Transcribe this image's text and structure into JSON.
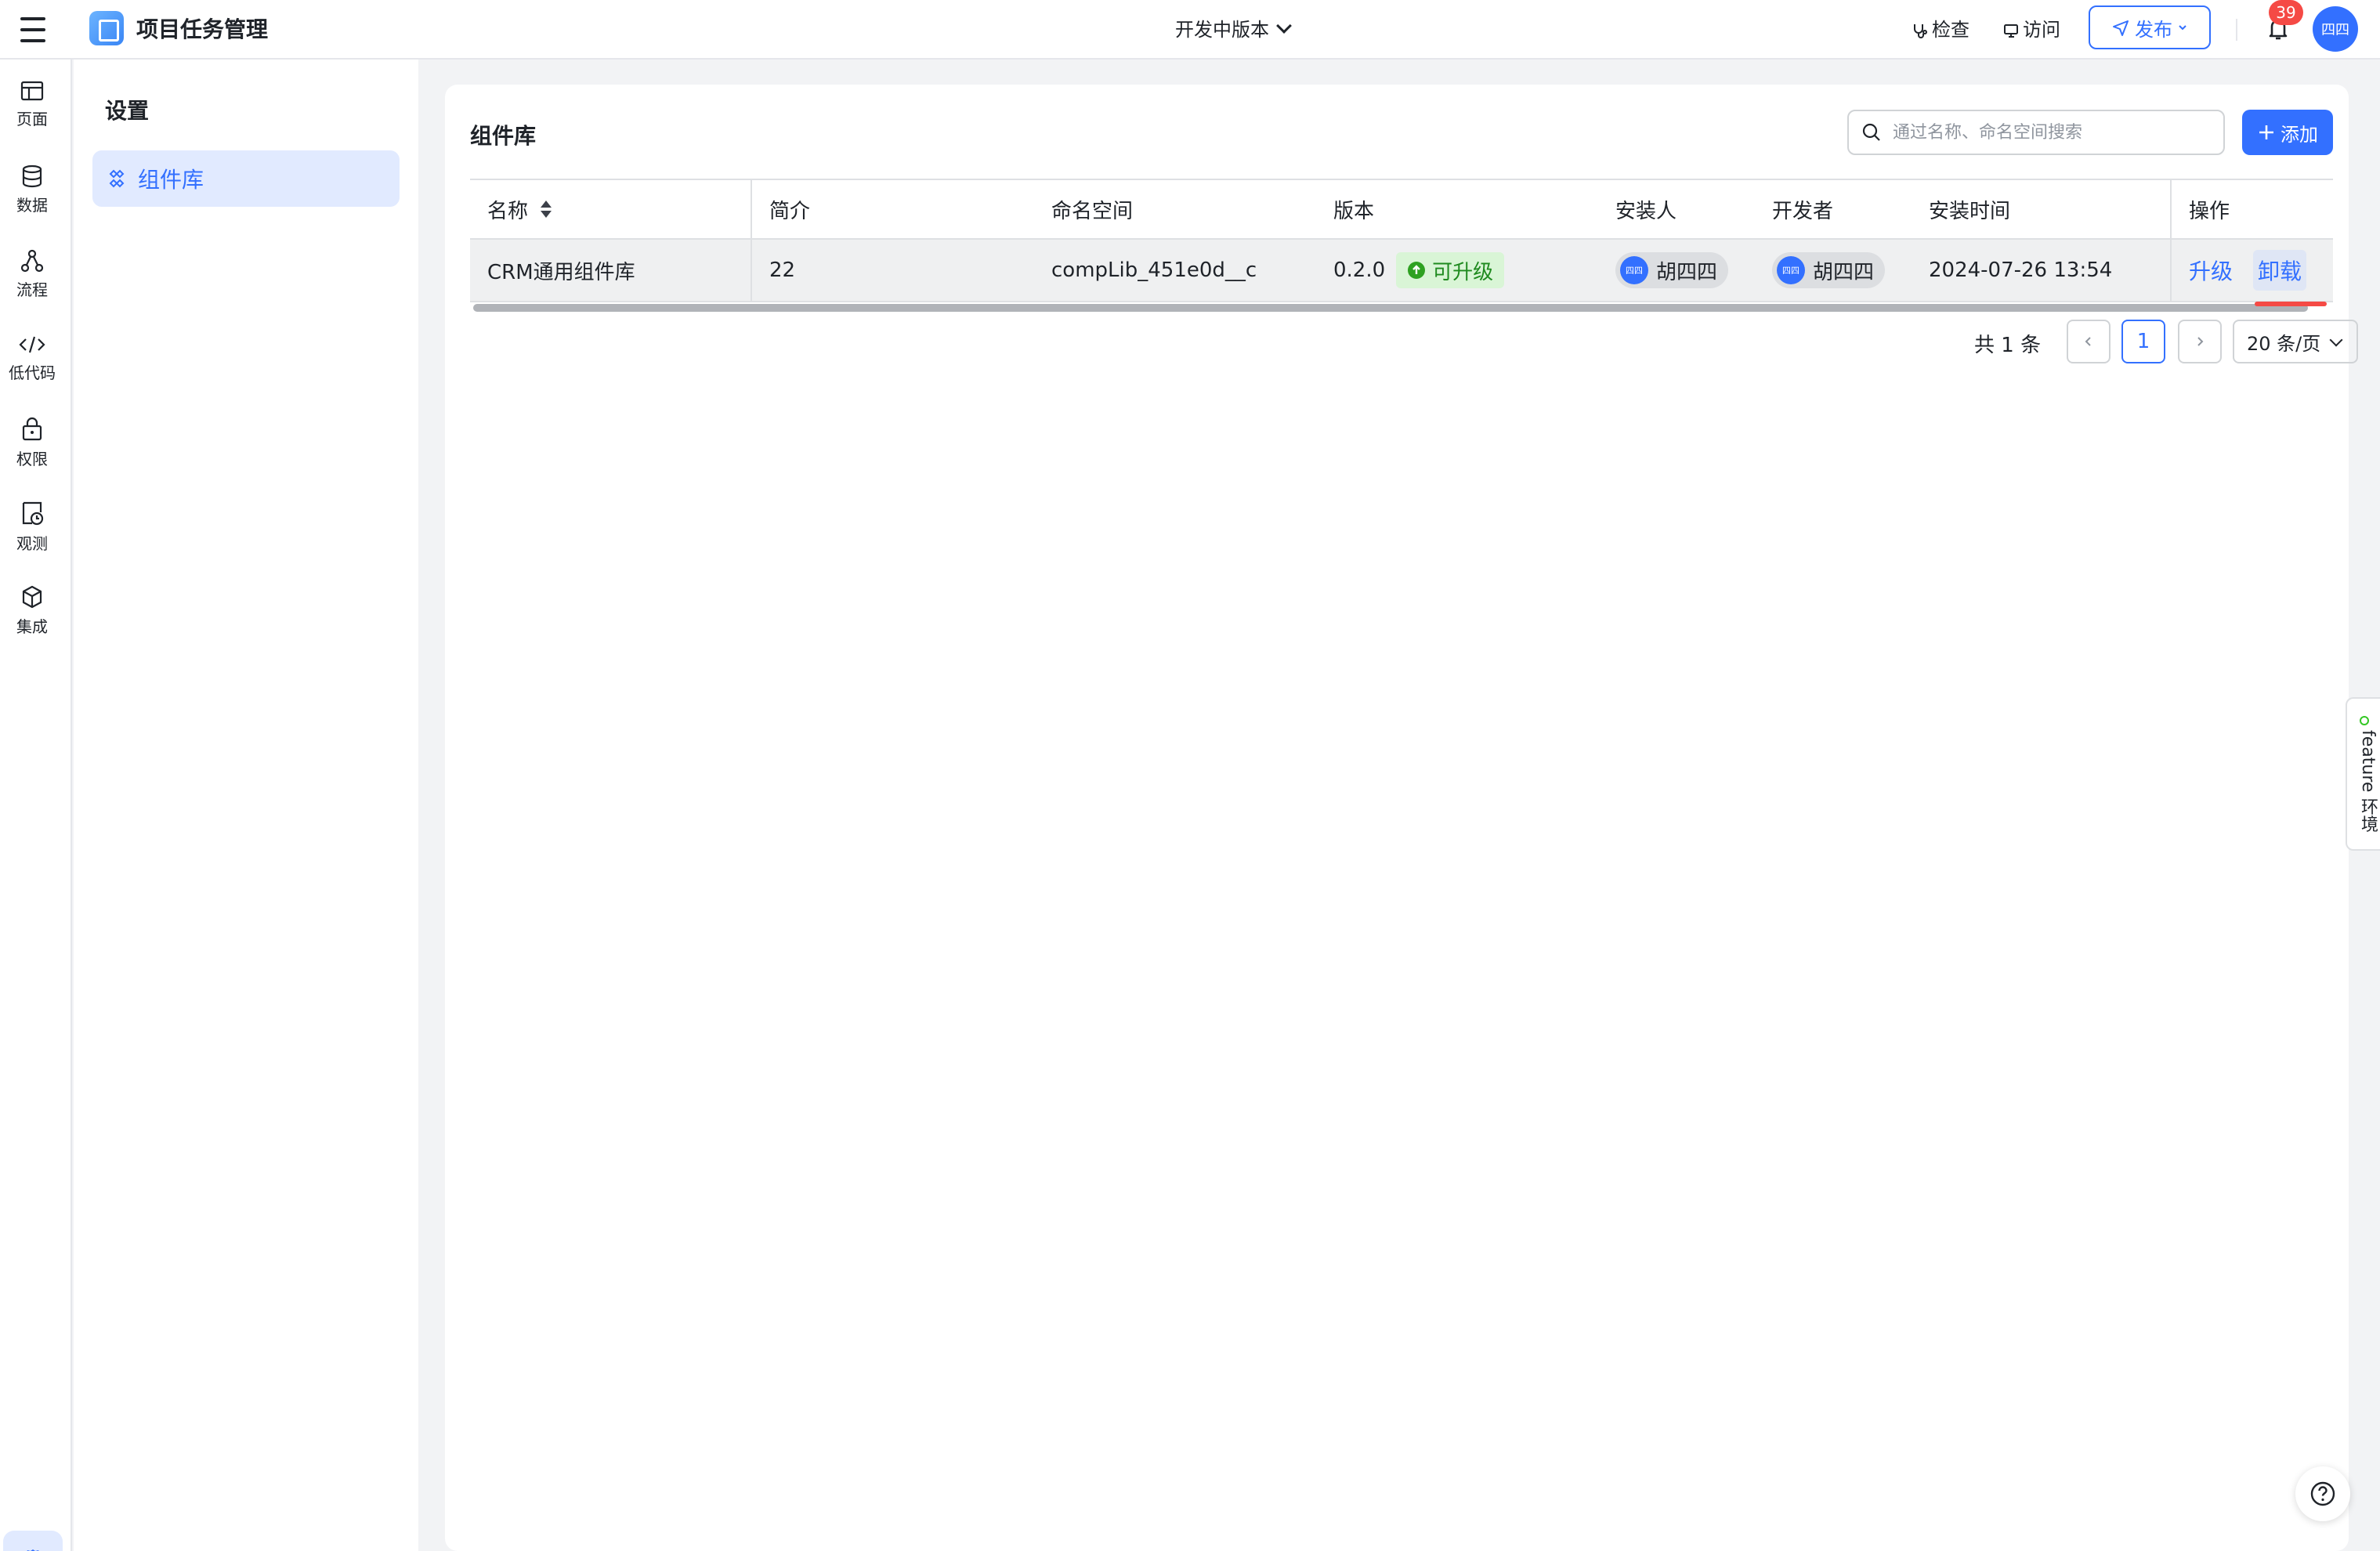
{
  "app": {
    "title": "项目任务管理",
    "version_label": "开发中版本",
    "actions": {
      "inspect": "检查",
      "visit": "访问",
      "publish": "发布"
    },
    "notifications": {
      "count": "39"
    },
    "user_avatar": "四四"
  },
  "rail": {
    "items": [
      {
        "label": "页面",
        "icon": "page-icon"
      },
      {
        "label": "数据",
        "icon": "database-icon"
      },
      {
        "label": "流程",
        "icon": "flow-icon"
      },
      {
        "label": "低代码",
        "icon": "code-icon"
      },
      {
        "label": "权限",
        "icon": "lock-icon"
      },
      {
        "label": "观测",
        "icon": "observe-icon"
      },
      {
        "label": "集成",
        "icon": "cube-icon"
      }
    ],
    "settings_icon": "gear-icon"
  },
  "settings": {
    "title": "设置",
    "items": [
      {
        "label": "组件库",
        "icon": "component-icon"
      }
    ]
  },
  "main": {
    "title": "组件库",
    "search": {
      "placeholder": "通过名称、命名空间搜索",
      "value": ""
    },
    "add_label": "添加",
    "table": {
      "columns": [
        "名称",
        "简介",
        "命名空间",
        "版本",
        "安装人",
        "开发者",
        "安装时间",
        "操作"
      ],
      "rows": [
        {
          "name": "CRM通用组件库",
          "intro": "22",
          "namespace": "compLib_451e0d__c",
          "version": "0.2.0",
          "version_tag": "可升级",
          "installer": "胡四四",
          "installer_avatar": "四四",
          "developer": "胡四四",
          "developer_avatar": "四四",
          "install_time": "2024-07-26 13:54",
          "actions": {
            "upgrade": "升级",
            "uninstall": "卸载"
          }
        }
      ]
    },
    "pagination": {
      "total_text": "共 1 条",
      "current_page": "1",
      "page_size": "20 条/页"
    }
  },
  "feature_tab": "feature 环境",
  "colors": {
    "primary": "#3370ff",
    "danger": "#f54a45",
    "success_bg": "#d9f5d6",
    "success_text": "#1f8a1f"
  }
}
